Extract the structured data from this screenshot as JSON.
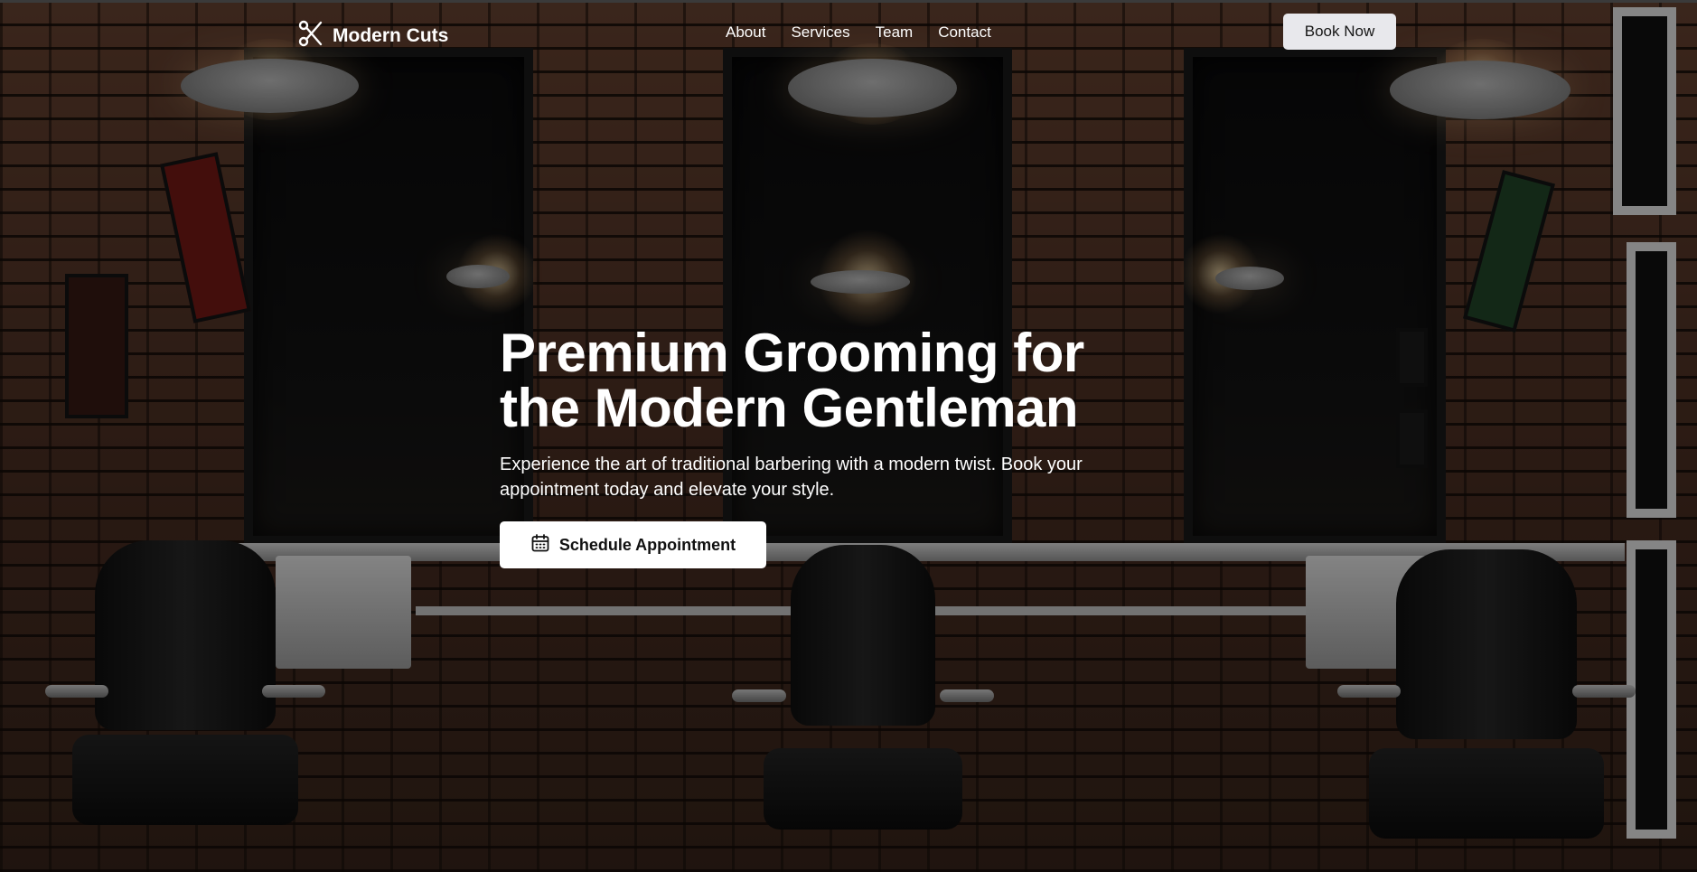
{
  "brand": {
    "name": "Modern Cuts",
    "icon": "scissors-icon"
  },
  "nav": {
    "links": [
      {
        "label": "About"
      },
      {
        "label": "Services"
      },
      {
        "label": "Team"
      },
      {
        "label": "Contact"
      }
    ],
    "cta_label": "Book Now"
  },
  "hero": {
    "headline_line1": "Premium Grooming for",
    "headline_line2": "the Modern Gentleman",
    "subtitle": "Experience the art of traditional barbering with a modern twist. Book your appointment today and elevate your style.",
    "cta_label": "Schedule Appointment",
    "cta_icon": "calendar-icon",
    "background": "barbershop-interior-photo"
  },
  "colors": {
    "text": "#ffffff",
    "book_button_bg": "#e8e8ec",
    "cta_bg": "#ffffff",
    "overlay": "rgba(0,0,0,0.45)"
  }
}
